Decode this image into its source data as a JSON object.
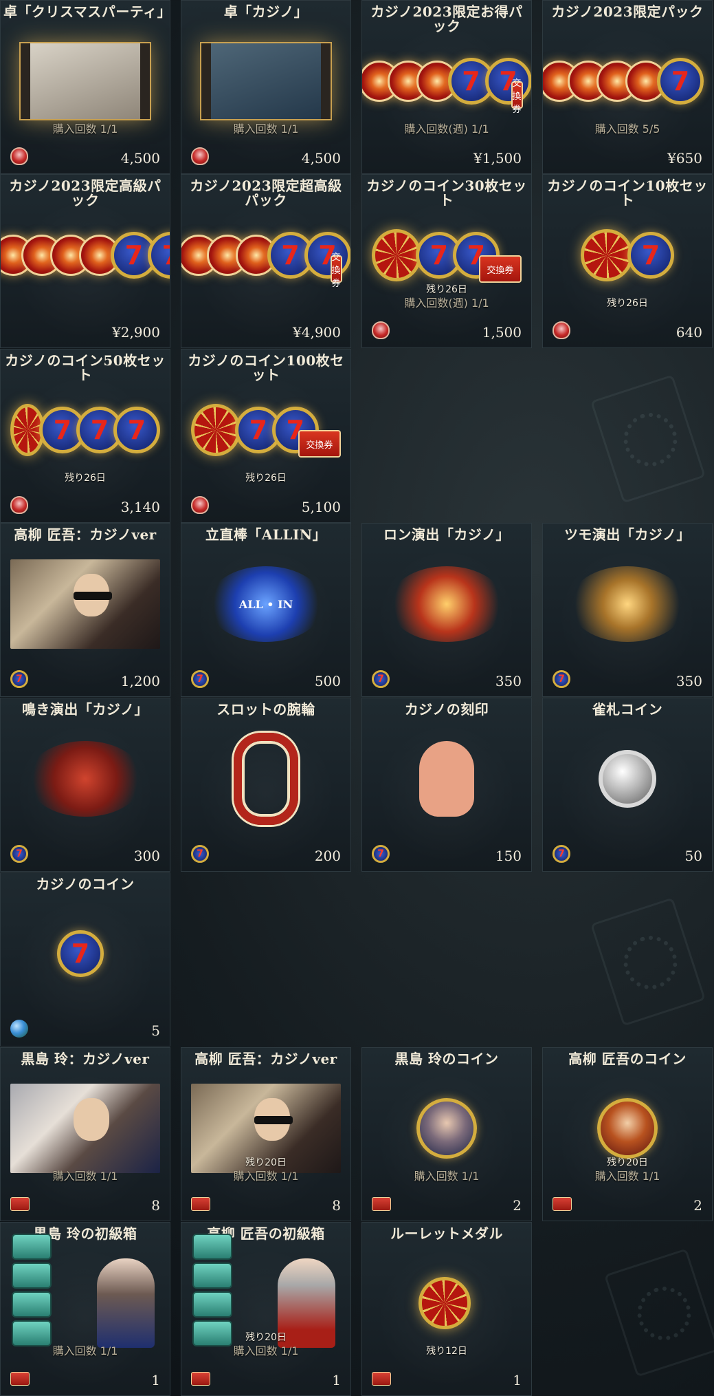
{
  "items": [
    {
      "title": "卓「クリスマスパーティ」",
      "art": "table-christmas",
      "notes": [
        "購入回数 1/1"
      ],
      "currency": "shield-coin-icon",
      "price": "4,500"
    },
    {
      "title": "卓「カジノ」",
      "art": "table-casino",
      "notes": [
        "購入回数 1/1"
      ],
      "currency": "shield-coin-icon",
      "price": "4,500"
    },
    {
      "title": "カジノ2023限定お得パック",
      "art": "chips-coins-ticket",
      "notes": [
        "購入回数(週) 1/1"
      ],
      "currency": "",
      "price": "¥1,500"
    },
    {
      "title": "カジノ2023限定パック",
      "art": "chips-coin",
      "notes": [
        "購入回数 5/5"
      ],
      "currency": "",
      "price": "¥650"
    },
    {
      "title": "カジノ2023限定高級パック",
      "art": "chips-coins",
      "notes": [],
      "currency": "",
      "price": "¥2,900"
    },
    {
      "title": "カジノ2023限定超高級パック",
      "art": "chips-coins-ticket",
      "notes": [],
      "currency": "",
      "price": "¥4,900"
    },
    {
      "title": "カジノのコイン30枚セット",
      "art": "roulette-coins-ticket",
      "notes": [
        "残り26日",
        "購入回数(週) 1/1"
      ],
      "currency": "shield-coin-icon",
      "price": "1,500"
    },
    {
      "title": "カジノのコイン10枚セット",
      "art": "roulette-coin",
      "notes": [
        "残り26日"
      ],
      "currency": "shield-coin-icon",
      "price": "640"
    },
    {
      "title": "カジノのコイン50枚セット",
      "art": "roulette-coins",
      "notes": [
        "残り26日"
      ],
      "currency": "shield-coin-icon",
      "price": "3,140"
    },
    {
      "title": "カジノのコイン100枚セット",
      "art": "roulette-coins-ticket",
      "notes": [
        "残り26日"
      ],
      "currency": "shield-coin-icon",
      "price": "5,100"
    },
    {
      "title": "高柳 匠吾：カジノver",
      "art": "portrait-male",
      "notes": [],
      "currency": "casino-coin-icon",
      "price": "1,200"
    },
    {
      "title": "立直棒「ALLIN」",
      "art": "riichi-allin",
      "notes": [],
      "currency": "casino-coin-icon",
      "price": "500"
    },
    {
      "title": "ロン演出「カジノ」",
      "art": "ron-effect",
      "notes": [],
      "currency": "casino-coin-icon",
      "price": "350"
    },
    {
      "title": "ツモ演出「カジノ」",
      "art": "tsumo-effect",
      "notes": [],
      "currency": "casino-coin-icon",
      "price": "350"
    },
    {
      "title": "鳴き演出「カジノ」",
      "art": "naki-effect",
      "notes": [],
      "currency": "casino-coin-icon",
      "price": "300"
    },
    {
      "title": "スロットの腕輪",
      "art": "bracelet",
      "notes": [],
      "currency": "casino-coin-icon",
      "price": "200"
    },
    {
      "title": "カジノの刻印",
      "art": "hand-mark",
      "notes": [],
      "currency": "casino-coin-icon",
      "price": "150"
    },
    {
      "title": "雀札コイン",
      "art": "silver-coin",
      "notes": [],
      "currency": "casino-coin-icon",
      "price": "50"
    },
    {
      "title": "カジノのコイン",
      "art": "casino-coin",
      "notes": [],
      "currency": "globe-coin-icon",
      "price": "5"
    },
    {
      "title": "黒島 玲：カジノver",
      "art": "portrait-female",
      "notes": [
        "購入回数 1/1"
      ],
      "currency": "exchange-ticket-icon",
      "price": "8"
    },
    {
      "title": "高柳 匠吾：カジノver",
      "art": "portrait-male",
      "notes": [
        "残り20日",
        "購入回数 1/1"
      ],
      "currency": "exchange-ticket-icon",
      "price": "8"
    },
    {
      "title": "黒島 玲のコイン",
      "art": "char-coin-female",
      "notes": [
        "購入回数 1/1"
      ],
      "currency": "exchange-ticket-icon",
      "price": "2"
    },
    {
      "title": "高柳 匠吾のコイン",
      "art": "char-coin-male",
      "notes": [
        "残り20日",
        "購入回数 1/1"
      ],
      "currency": "exchange-ticket-icon",
      "price": "2"
    },
    {
      "title": "黒島 玲の初級箱",
      "art": "box-female",
      "notes": [
        "購入回数 1/1"
      ],
      "currency": "exchange-ticket-icon",
      "price": "1"
    },
    {
      "title": "高柳 匠吾の初級箱",
      "art": "box-male",
      "notes": [
        "残り20日",
        "購入回数 1/1"
      ],
      "currency": "exchange-ticket-icon",
      "price": "1"
    },
    {
      "title": "ルーレットメダル",
      "art": "roulette-medal",
      "notes": [
        "残り12日"
      ],
      "currency": "exchange-ticket-icon",
      "price": "1"
    }
  ],
  "icon_labels": {
    "ticket_text": "交換券",
    "allin_text": "ALL • IN",
    "seven": "7"
  },
  "colors": {
    "card_bg": "#1b252b",
    "card_border": "#2d393f",
    "title": "#f1ead8",
    "note": "#b9b09a",
    "price": "#f2ecdd"
  }
}
